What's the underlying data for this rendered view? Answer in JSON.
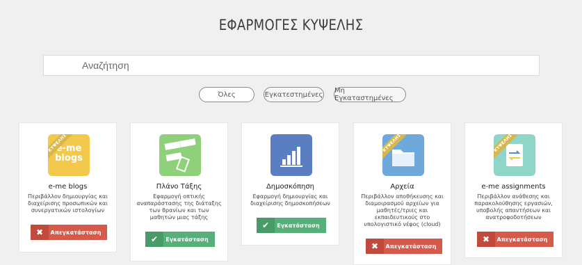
{
  "header": {
    "title": "ΕΦΑΡΜΟΓΕΣ ΚΥΨΕΛΗΣ"
  },
  "search": {
    "placeholder": "Αναζήτηση"
  },
  "filters": [
    {
      "label": "Όλες"
    },
    {
      "label": "Εγκατεστημένες"
    },
    {
      "label": "Μη Εγκαταστημένες"
    }
  ],
  "ribbon_text": "ΚΥΨΕΛΗΣ",
  "apps": [
    {
      "name": "e-me blogs",
      "description": "Περιβάλλον δημιουργίας και διαχείρισης προσωπικών και συνεργατικών ιστολογίων",
      "icon": "blogs-icon",
      "icon_text": "e-me blogs",
      "icon_color": "#f2c94c",
      "ribbon": true,
      "action": {
        "type": "uninstall",
        "label": "Απεγκατάσταση",
        "glyph": "✖"
      }
    },
    {
      "name": "Πλάνο Τάξης",
      "description": "Εφαρμογή οπτικής αναπαράστασης της διάταξης των θρανίων και των μαθητών μιας τάξης",
      "icon": "classroom-plan-icon",
      "icon_color": "#8fd17b",
      "ribbon": false,
      "action": {
        "type": "install",
        "label": "Εγκατάσταση",
        "glyph": "✔"
      }
    },
    {
      "name": "Δημοσκόπηση",
      "description": "Εφαρμογή δημιουργίας και διαχείρισης δημοσκοπήσεων",
      "icon": "poll-chart-icon",
      "icon_color": "#5b7ec2",
      "ribbon": false,
      "action": {
        "type": "install",
        "label": "Εγκατάσταση",
        "glyph": "✔"
      }
    },
    {
      "name": "Αρχεία",
      "description": "Περιβάλλον αποθήκευσης και διαμοιρασμού αρχείων για μαθητές/τριες και εκπαιδευτικούς στο υπολογιστικό νέφος (cloud)",
      "icon": "folder-icon",
      "icon_color": "#6fa9dc",
      "ribbon": true,
      "action": {
        "type": "uninstall",
        "label": "Απεγκατάσταση",
        "glyph": "✖"
      }
    },
    {
      "name": "e-me assignments",
      "description": "Περιβάλλον ανάθεσης και παρακολούθησης εργασιών, υποβολής απαντήσεων και ανατροφοδοτήσεων",
      "icon": "assignments-icon",
      "icon_color": "#8fd6c9",
      "ribbon": true,
      "action": {
        "type": "uninstall",
        "label": "Απεγκατάσταση",
        "glyph": "✖"
      }
    }
  ]
}
